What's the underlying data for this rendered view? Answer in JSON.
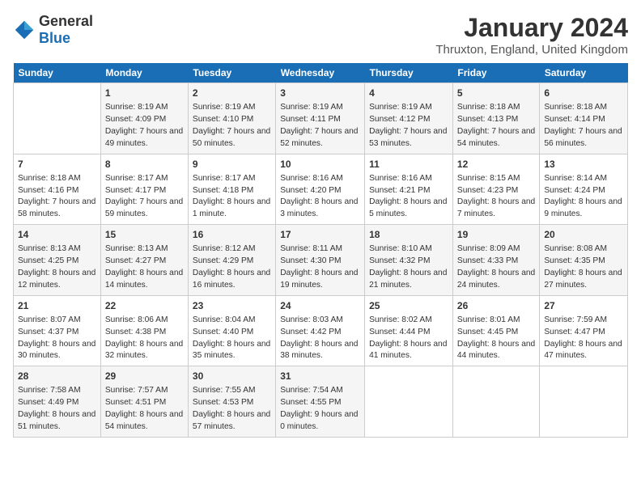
{
  "header": {
    "logo_general": "General",
    "logo_blue": "Blue",
    "month": "January 2024",
    "location": "Thruxton, England, United Kingdom"
  },
  "days_of_week": [
    "Sunday",
    "Monday",
    "Tuesday",
    "Wednesday",
    "Thursday",
    "Friday",
    "Saturday"
  ],
  "weeks": [
    [
      {
        "day": "",
        "sunrise": "",
        "sunset": "",
        "daylight": ""
      },
      {
        "day": "1",
        "sunrise": "Sunrise: 8:19 AM",
        "sunset": "Sunset: 4:09 PM",
        "daylight": "Daylight: 7 hours and 49 minutes."
      },
      {
        "day": "2",
        "sunrise": "Sunrise: 8:19 AM",
        "sunset": "Sunset: 4:10 PM",
        "daylight": "Daylight: 7 hours and 50 minutes."
      },
      {
        "day": "3",
        "sunrise": "Sunrise: 8:19 AM",
        "sunset": "Sunset: 4:11 PM",
        "daylight": "Daylight: 7 hours and 52 minutes."
      },
      {
        "day": "4",
        "sunrise": "Sunrise: 8:19 AM",
        "sunset": "Sunset: 4:12 PM",
        "daylight": "Daylight: 7 hours and 53 minutes."
      },
      {
        "day": "5",
        "sunrise": "Sunrise: 8:18 AM",
        "sunset": "Sunset: 4:13 PM",
        "daylight": "Daylight: 7 hours and 54 minutes."
      },
      {
        "day": "6",
        "sunrise": "Sunrise: 8:18 AM",
        "sunset": "Sunset: 4:14 PM",
        "daylight": "Daylight: 7 hours and 56 minutes."
      }
    ],
    [
      {
        "day": "7",
        "sunrise": "Sunrise: 8:18 AM",
        "sunset": "Sunset: 4:16 PM",
        "daylight": "Daylight: 7 hours and 58 minutes."
      },
      {
        "day": "8",
        "sunrise": "Sunrise: 8:17 AM",
        "sunset": "Sunset: 4:17 PM",
        "daylight": "Daylight: 7 hours and 59 minutes."
      },
      {
        "day": "9",
        "sunrise": "Sunrise: 8:17 AM",
        "sunset": "Sunset: 4:18 PM",
        "daylight": "Daylight: 8 hours and 1 minute."
      },
      {
        "day": "10",
        "sunrise": "Sunrise: 8:16 AM",
        "sunset": "Sunset: 4:20 PM",
        "daylight": "Daylight: 8 hours and 3 minutes."
      },
      {
        "day": "11",
        "sunrise": "Sunrise: 8:16 AM",
        "sunset": "Sunset: 4:21 PM",
        "daylight": "Daylight: 8 hours and 5 minutes."
      },
      {
        "day": "12",
        "sunrise": "Sunrise: 8:15 AM",
        "sunset": "Sunset: 4:23 PM",
        "daylight": "Daylight: 8 hours and 7 minutes."
      },
      {
        "day": "13",
        "sunrise": "Sunrise: 8:14 AM",
        "sunset": "Sunset: 4:24 PM",
        "daylight": "Daylight: 8 hours and 9 minutes."
      }
    ],
    [
      {
        "day": "14",
        "sunrise": "Sunrise: 8:13 AM",
        "sunset": "Sunset: 4:25 PM",
        "daylight": "Daylight: 8 hours and 12 minutes."
      },
      {
        "day": "15",
        "sunrise": "Sunrise: 8:13 AM",
        "sunset": "Sunset: 4:27 PM",
        "daylight": "Daylight: 8 hours and 14 minutes."
      },
      {
        "day": "16",
        "sunrise": "Sunrise: 8:12 AM",
        "sunset": "Sunset: 4:29 PM",
        "daylight": "Daylight: 8 hours and 16 minutes."
      },
      {
        "day": "17",
        "sunrise": "Sunrise: 8:11 AM",
        "sunset": "Sunset: 4:30 PM",
        "daylight": "Daylight: 8 hours and 19 minutes."
      },
      {
        "day": "18",
        "sunrise": "Sunrise: 8:10 AM",
        "sunset": "Sunset: 4:32 PM",
        "daylight": "Daylight: 8 hours and 21 minutes."
      },
      {
        "day": "19",
        "sunrise": "Sunrise: 8:09 AM",
        "sunset": "Sunset: 4:33 PM",
        "daylight": "Daylight: 8 hours and 24 minutes."
      },
      {
        "day": "20",
        "sunrise": "Sunrise: 8:08 AM",
        "sunset": "Sunset: 4:35 PM",
        "daylight": "Daylight: 8 hours and 27 minutes."
      }
    ],
    [
      {
        "day": "21",
        "sunrise": "Sunrise: 8:07 AM",
        "sunset": "Sunset: 4:37 PM",
        "daylight": "Daylight: 8 hours and 30 minutes."
      },
      {
        "day": "22",
        "sunrise": "Sunrise: 8:06 AM",
        "sunset": "Sunset: 4:38 PM",
        "daylight": "Daylight: 8 hours and 32 minutes."
      },
      {
        "day": "23",
        "sunrise": "Sunrise: 8:04 AM",
        "sunset": "Sunset: 4:40 PM",
        "daylight": "Daylight: 8 hours and 35 minutes."
      },
      {
        "day": "24",
        "sunrise": "Sunrise: 8:03 AM",
        "sunset": "Sunset: 4:42 PM",
        "daylight": "Daylight: 8 hours and 38 minutes."
      },
      {
        "day": "25",
        "sunrise": "Sunrise: 8:02 AM",
        "sunset": "Sunset: 4:44 PM",
        "daylight": "Daylight: 8 hours and 41 minutes."
      },
      {
        "day": "26",
        "sunrise": "Sunrise: 8:01 AM",
        "sunset": "Sunset: 4:45 PM",
        "daylight": "Daylight: 8 hours and 44 minutes."
      },
      {
        "day": "27",
        "sunrise": "Sunrise: 7:59 AM",
        "sunset": "Sunset: 4:47 PM",
        "daylight": "Daylight: 8 hours and 47 minutes."
      }
    ],
    [
      {
        "day": "28",
        "sunrise": "Sunrise: 7:58 AM",
        "sunset": "Sunset: 4:49 PM",
        "daylight": "Daylight: 8 hours and 51 minutes."
      },
      {
        "day": "29",
        "sunrise": "Sunrise: 7:57 AM",
        "sunset": "Sunset: 4:51 PM",
        "daylight": "Daylight: 8 hours and 54 minutes."
      },
      {
        "day": "30",
        "sunrise": "Sunrise: 7:55 AM",
        "sunset": "Sunset: 4:53 PM",
        "daylight": "Daylight: 8 hours and 57 minutes."
      },
      {
        "day": "31",
        "sunrise": "Sunrise: 7:54 AM",
        "sunset": "Sunset: 4:55 PM",
        "daylight": "Daylight: 9 hours and 0 minutes."
      },
      {
        "day": "",
        "sunrise": "",
        "sunset": "",
        "daylight": ""
      },
      {
        "day": "",
        "sunrise": "",
        "sunset": "",
        "daylight": ""
      },
      {
        "day": "",
        "sunrise": "",
        "sunset": "",
        "daylight": ""
      }
    ]
  ]
}
